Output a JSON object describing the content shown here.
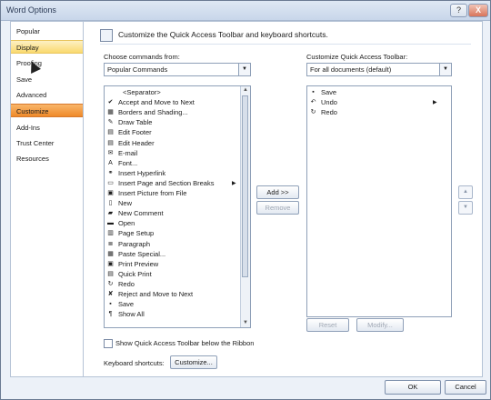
{
  "window": {
    "title": "Word Options",
    "help_label": "?",
    "close_label": "X"
  },
  "nav": {
    "items": [
      {
        "label": "Popular",
        "state": "normal"
      },
      {
        "label": "Display",
        "state": "hover"
      },
      {
        "label": "Proofing",
        "state": "normal"
      },
      {
        "label": "Save",
        "state": "normal"
      },
      {
        "label": "Advanced",
        "state": "normal"
      },
      {
        "label": "Customize",
        "state": "selected"
      },
      {
        "label": "Add-Ins",
        "state": "normal"
      },
      {
        "label": "Trust Center",
        "state": "normal"
      },
      {
        "label": "Resources",
        "state": "normal"
      }
    ]
  },
  "content": {
    "banner": "Customize the Quick Access Toolbar and keyboard shortcuts.",
    "choose_label": "Choose commands from:",
    "choose_value": "Popular Commands",
    "customize_label": "Customize Quick Access Toolbar:",
    "customize_value": "For all documents (default)",
    "commands": [
      {
        "label": "<Separator>",
        "icon": "separator-icon",
        "glyph": "",
        "submenu": false
      },
      {
        "label": "Accept and Move to Next",
        "icon": "accept-icon",
        "glyph": "✔",
        "submenu": false
      },
      {
        "label": "Borders and Shading...",
        "icon": "borders-icon",
        "glyph": "▦",
        "submenu": false
      },
      {
        "label": "Draw Table",
        "icon": "draw-table-icon",
        "glyph": "✎",
        "submenu": false
      },
      {
        "label": "Edit Footer",
        "icon": "edit-footer-icon",
        "glyph": "▤",
        "submenu": false
      },
      {
        "label": "Edit Header",
        "icon": "edit-header-icon",
        "glyph": "▤",
        "submenu": false
      },
      {
        "label": "E-mail",
        "icon": "email-icon",
        "glyph": "✉",
        "submenu": false
      },
      {
        "label": "Font...",
        "icon": "font-icon",
        "glyph": "A",
        "submenu": false
      },
      {
        "label": "Insert Hyperlink",
        "icon": "hyperlink-icon",
        "glyph": "⚭",
        "submenu": false
      },
      {
        "label": "Insert Page and Section Breaks",
        "icon": "page-break-icon",
        "glyph": "▭",
        "submenu": true
      },
      {
        "label": "Insert Picture from File",
        "icon": "picture-icon",
        "glyph": "▣",
        "submenu": false
      },
      {
        "label": "New",
        "icon": "new-doc-icon",
        "glyph": "▯",
        "submenu": false
      },
      {
        "label": "New Comment",
        "icon": "comment-icon",
        "glyph": "▰",
        "submenu": false
      },
      {
        "label": "Open",
        "icon": "open-folder-icon",
        "glyph": "▬",
        "submenu": false
      },
      {
        "label": "Page Setup",
        "icon": "page-setup-icon",
        "glyph": "▥",
        "submenu": false
      },
      {
        "label": "Paragraph",
        "icon": "paragraph-icon",
        "glyph": "≣",
        "submenu": false
      },
      {
        "label": "Paste Special...",
        "icon": "paste-icon",
        "glyph": "▦",
        "submenu": false
      },
      {
        "label": "Print Preview",
        "icon": "print-preview-icon",
        "glyph": "▣",
        "submenu": false
      },
      {
        "label": "Quick Print",
        "icon": "quick-print-icon",
        "glyph": "▤",
        "submenu": false
      },
      {
        "label": "Redo",
        "icon": "redo-icon",
        "glyph": "↻",
        "submenu": false
      },
      {
        "label": "Reject and Move to Next",
        "icon": "reject-icon",
        "glyph": "✘",
        "submenu": false
      },
      {
        "label": "Save",
        "icon": "save-icon",
        "glyph": "▪",
        "submenu": false
      },
      {
        "label": "Show All",
        "icon": "show-all-icon",
        "glyph": "¶",
        "submenu": false
      }
    ],
    "toolbar_items": [
      {
        "label": "Save",
        "icon": "save-icon",
        "glyph": "▪",
        "submenu": false
      },
      {
        "label": "Undo",
        "icon": "undo-icon",
        "glyph": "↶",
        "submenu": true
      },
      {
        "label": "Redo",
        "icon": "redo-icon",
        "glyph": "↻",
        "submenu": false
      }
    ],
    "add_label": "Add >>",
    "remove_label": "Remove",
    "reset_label": "Reset",
    "modify_label": "Modify...",
    "show_below_label": "Show Quick Access Toolbar below the Ribbon",
    "keyboard_label": "Keyboard shortcuts:",
    "customize_button": "Customize..."
  },
  "footer": {
    "ok_label": "OK",
    "cancel_label": "Cancel"
  },
  "colors": {
    "selected": "#ef8a2a",
    "hover": "#fad96e",
    "border": "#8fa0b8"
  }
}
